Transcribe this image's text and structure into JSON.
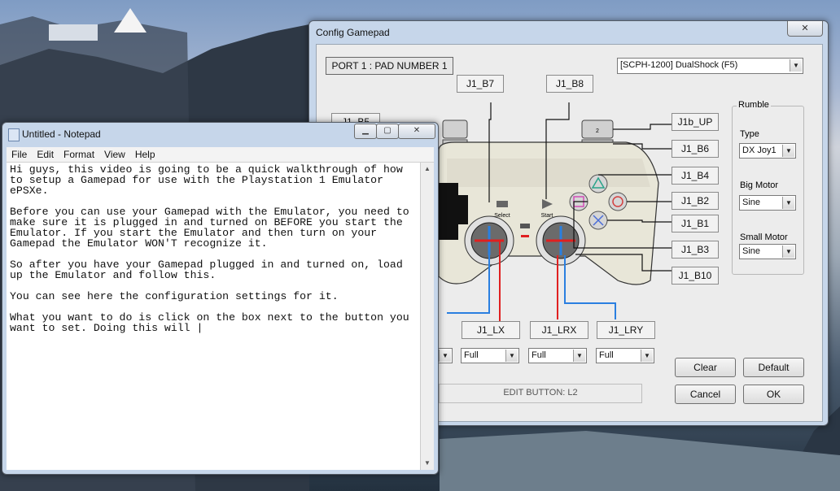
{
  "config_gamepad": {
    "title": "Config Gamepad",
    "close_icon": "close-icon",
    "port_label": "PORT 1 : PAD NUMBER 1",
    "pad_type": "[SCPH-1200] DualShock (F5)",
    "buttons": {
      "l2": "J1_B7",
      "r2": "J1_B8",
      "l1_partial": "J1_B5",
      "r_up": "J1b_UP",
      "r_b6": "J1_B6",
      "triangle": "J1_B4",
      "circle": "J1_B2",
      "cross": "J1_B1",
      "square": "J1_B3",
      "r3": "J1_B10",
      "lx": "J1_LX",
      "lrx": "J1_LRX",
      "lry": "J1_LRY"
    },
    "pad_labels": {
      "select": "Select",
      "start": "Start"
    },
    "axis_mode": {
      "a": "Full",
      "b": "Full",
      "c": "Full"
    },
    "rumble": {
      "group_title": "Rumble",
      "type_label": "Type",
      "type_value": "DX Joy1",
      "big_motor_label": "Big Motor",
      "big_motor_value": "Sine",
      "small_motor_label": "Small Motor",
      "small_motor_value": "Sine"
    },
    "status": "EDIT BUTTON: L2",
    "clear": "Clear",
    "default": "Default",
    "cancel": "Cancel",
    "ok": "OK"
  },
  "notepad": {
    "title": "Untitled - Notepad",
    "menu": [
      "File",
      "Edit",
      "Format",
      "View",
      "Help"
    ],
    "text": "Hi guys, this video is going to be a quick walkthrough of how\nto setup a Gamepad for use with the Playstation 1 Emulator\nePSXe.\n\nBefore you can use your Gamepad with the Emulator, you need to\nmake sure it is plugged in and turned on BEFORE you start the\nEmulator. If you start the Emulator and then turn on your\nGamepad the Emulator WON'T recognize it.\n\nSo after you have your Gamepad plugged in and turned on, load\nup the Emulator and follow this.\n\nYou can see here the configuration settings for it.\n\nWhat you want to do is click on the box next to the button you\nwant to set. Doing this will |"
  },
  "colors": {
    "red_wire": "#e02020",
    "blue_wire": "#2a7fe0",
    "pad_body": "#e8e6d8"
  }
}
